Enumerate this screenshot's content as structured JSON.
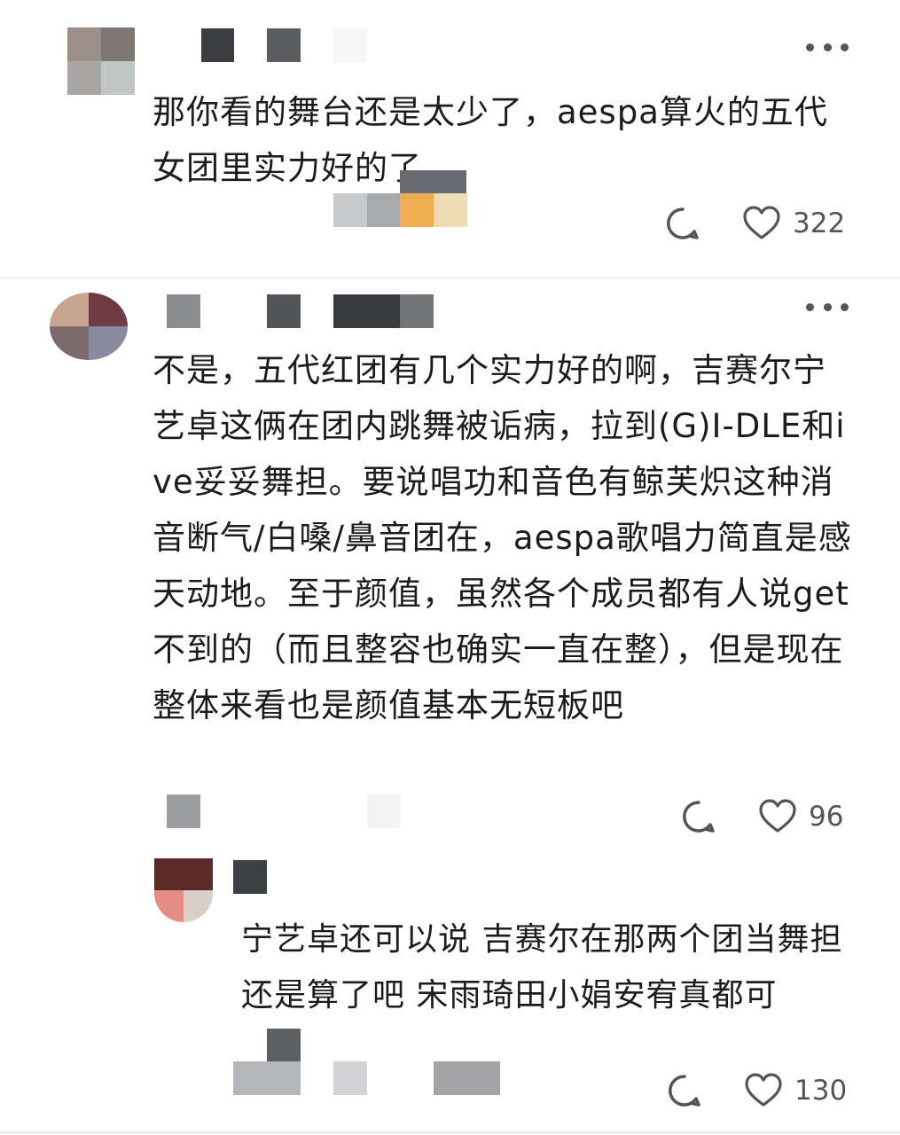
{
  "comments": [
    {
      "text": "那你看的舞台还是太少了，aespa算火的五代女团里实力好的了",
      "likes": "322"
    },
    {
      "text": "不是，五代红团有几个实力好的啊，吉赛尔宁艺卓这俩在团内跳舞被诟病，拉到(G)I-DLE和ive妥妥舞担。要说唱功和音色有鲸芙炽这种消音断气/白嗓/鼻音团在，aespa歌唱力简直是感天动地。至于颜值，虽然各个成员都有人说get不到的（而且整容也确实一直在整），但是现在整体来看也是颜值基本无短板吧",
      "likes": "96"
    },
    {
      "text": "宁艺卓还可以说 吉赛尔在那两个团当舞担还是算了吧 宋雨琦田小娟安宥真都可",
      "likes": "130"
    }
  ],
  "icons": {
    "reply": "comment-bubble-icon",
    "like": "heart-outline-icon",
    "more": "more-dots-icon"
  }
}
